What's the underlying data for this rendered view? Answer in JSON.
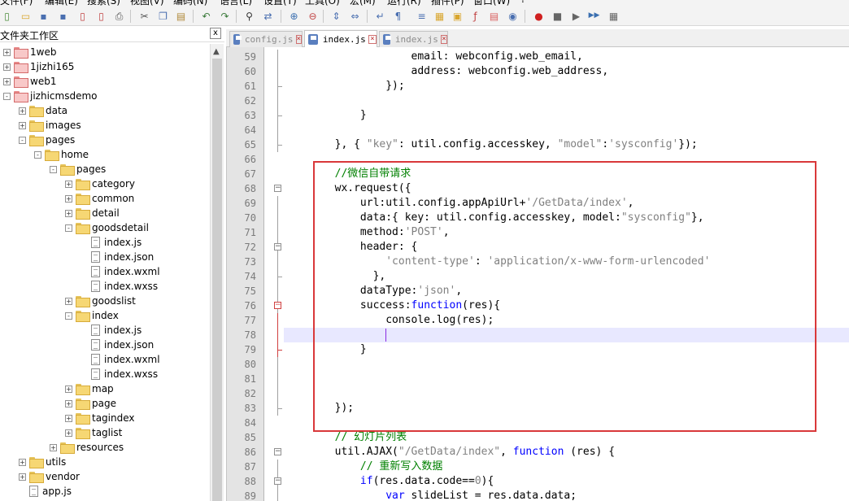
{
  "menubar": {
    "items": [
      "文件(F)",
      "编辑(E)",
      "搜索(S)",
      "视图(V)",
      "编码(N)",
      "语言(L)",
      "设置(T)",
      "工具(O)",
      "宏(M)",
      "运行(R)",
      "插件(P)",
      "窗口(W)",
      "?"
    ]
  },
  "toolbar": {
    "buttons": [
      "new-file-icon",
      "open-file-icon",
      "save-icon",
      "save-all-icon",
      "close-icon",
      "close-all-icon",
      "print-icon",
      "cut-icon",
      "copy-icon",
      "paste-icon",
      "undo-icon",
      "redo-icon",
      "find-icon",
      "replace-icon",
      "zoom-in-icon",
      "zoom-out-icon",
      "sync-vertical-icon",
      "sync-horizontal-icon",
      "word-wrap-icon",
      "show-all-chars-icon",
      "indent-guide-icon",
      "udl-icon",
      "doc-map-icon",
      "function-list-icon",
      "folder-workspace-icon",
      "monitor-icon",
      "record-macro-icon",
      "stop-macro-icon",
      "play-macro-icon",
      "run-macro-multiple-icon",
      "save-macro-icon"
    ]
  },
  "workspace": {
    "title": "文件夹工作区",
    "close_label": "x",
    "tree": [
      {
        "label": "1web",
        "level": 0,
        "type": "folder",
        "color": "red",
        "expander": "+"
      },
      {
        "label": "1jizhi165",
        "level": 0,
        "type": "folder",
        "color": "red",
        "expander": "+"
      },
      {
        "label": "web1",
        "level": 0,
        "type": "folder",
        "color": "red",
        "expander": "+"
      },
      {
        "label": "jizhicmsdemo",
        "level": 0,
        "type": "folder",
        "color": "red",
        "expander": "-"
      },
      {
        "label": "data",
        "level": 1,
        "type": "folder",
        "color": "yellow",
        "expander": "+"
      },
      {
        "label": "images",
        "level": 1,
        "type": "folder",
        "color": "yellow",
        "expander": "+"
      },
      {
        "label": "pages",
        "level": 1,
        "type": "folder",
        "color": "yellow",
        "expander": "-"
      },
      {
        "label": "home",
        "level": 2,
        "type": "folder",
        "color": "yellow",
        "expander": "-"
      },
      {
        "label": "pages",
        "level": 3,
        "type": "folder",
        "color": "yellow",
        "expander": "-"
      },
      {
        "label": "category",
        "level": 4,
        "type": "folder",
        "color": "yellow",
        "expander": "+"
      },
      {
        "label": "common",
        "level": 4,
        "type": "folder",
        "color": "yellow",
        "expander": "+"
      },
      {
        "label": "detail",
        "level": 4,
        "type": "folder",
        "color": "yellow",
        "expander": "+"
      },
      {
        "label": "goodsdetail",
        "level": 4,
        "type": "folder",
        "color": "yellow",
        "expander": "-"
      },
      {
        "label": "index.js",
        "level": 5,
        "type": "file"
      },
      {
        "label": "index.json",
        "level": 5,
        "type": "file"
      },
      {
        "label": "index.wxml",
        "level": 5,
        "type": "file"
      },
      {
        "label": "index.wxss",
        "level": 5,
        "type": "file"
      },
      {
        "label": "goodslist",
        "level": 4,
        "type": "folder",
        "color": "yellow",
        "expander": "+"
      },
      {
        "label": "index",
        "level": 4,
        "type": "folder",
        "color": "yellow",
        "expander": "-"
      },
      {
        "label": "index.js",
        "level": 5,
        "type": "file"
      },
      {
        "label": "index.json",
        "level": 5,
        "type": "file"
      },
      {
        "label": "index.wxml",
        "level": 5,
        "type": "file"
      },
      {
        "label": "index.wxss",
        "level": 5,
        "type": "file"
      },
      {
        "label": "map",
        "level": 4,
        "type": "folder",
        "color": "yellow",
        "expander": "+"
      },
      {
        "label": "page",
        "level": 4,
        "type": "folder",
        "color": "yellow",
        "expander": "+"
      },
      {
        "label": "tagindex",
        "level": 4,
        "type": "folder",
        "color": "yellow",
        "expander": "+"
      },
      {
        "label": "taglist",
        "level": 4,
        "type": "folder",
        "color": "yellow",
        "expander": "+"
      },
      {
        "label": "resources",
        "level": 3,
        "type": "folder",
        "color": "yellow",
        "expander": "+"
      },
      {
        "label": "utils",
        "level": 1,
        "type": "folder",
        "color": "yellow",
        "expander": "+"
      },
      {
        "label": "vendor",
        "level": 1,
        "type": "folder",
        "color": "yellow",
        "expander": "+"
      },
      {
        "label": "app.js",
        "level": 1,
        "type": "file"
      }
    ]
  },
  "tabs": [
    {
      "label": "config.js",
      "active": false
    },
    {
      "label": "index.js",
      "active": true
    },
    {
      "label": "index.js",
      "active": false
    }
  ],
  "editor": {
    "current_line": 78,
    "lines": [
      {
        "n": 59,
        "tokens": [
          [
            "pl",
            "                    email: webconfig.web_email,"
          ]
        ]
      },
      {
        "n": 60,
        "tokens": [
          [
            "pl",
            "                    address: webconfig.web_address,"
          ]
        ]
      },
      {
        "n": 61,
        "tokens": [
          [
            "pl",
            "                });"
          ]
        ]
      },
      {
        "n": 62,
        "tokens": []
      },
      {
        "n": 63,
        "tokens": [
          [
            "pl",
            "            }"
          ]
        ]
      },
      {
        "n": 64,
        "tokens": []
      },
      {
        "n": 65,
        "tokens": [
          [
            "pl",
            "        }, { "
          ],
          [
            "str",
            "\"key\""
          ],
          [
            "pl",
            ": util.config.accesskey, "
          ],
          [
            "str",
            "\"model\""
          ],
          [
            "pl",
            ":"
          ],
          [
            "str",
            "'sysconfig'"
          ],
          [
            "pl",
            "});"
          ]
        ]
      },
      {
        "n": 66,
        "tokens": []
      },
      {
        "n": 67,
        "tokens": [
          [
            "cm",
            "        //微信自带请求"
          ]
        ]
      },
      {
        "n": 68,
        "tokens": [
          [
            "pl",
            "        wx.request({"
          ]
        ]
      },
      {
        "n": 69,
        "tokens": [
          [
            "pl",
            "            url:util.config.appApiUrl+"
          ],
          [
            "str",
            "'/GetData/index'"
          ],
          [
            "pl",
            ","
          ]
        ]
      },
      {
        "n": 70,
        "tokens": [
          [
            "pl",
            "            data:{ key: util.config.accesskey, model:"
          ],
          [
            "str",
            "\"sysconfig\""
          ],
          [
            "pl",
            "},"
          ]
        ]
      },
      {
        "n": 71,
        "tokens": [
          [
            "pl",
            "            method:"
          ],
          [
            "str",
            "'POST'"
          ],
          [
            "pl",
            ","
          ]
        ]
      },
      {
        "n": 72,
        "tokens": [
          [
            "pl",
            "            header: {"
          ]
        ]
      },
      {
        "n": 73,
        "tokens": [
          [
            "pl",
            "                "
          ],
          [
            "str",
            "'content-type'"
          ],
          [
            "pl",
            ": "
          ],
          [
            "str",
            "'application/x-www-form-urlencoded'"
          ]
        ]
      },
      {
        "n": 74,
        "tokens": [
          [
            "pl",
            "              },"
          ]
        ]
      },
      {
        "n": 75,
        "tokens": [
          [
            "pl",
            "            dataType:"
          ],
          [
            "str",
            "'json'"
          ],
          [
            "pl",
            ","
          ]
        ]
      },
      {
        "n": 76,
        "tokens": [
          [
            "pl",
            "            success:"
          ],
          [
            "kw",
            "function"
          ],
          [
            "pl",
            "(res){"
          ]
        ]
      },
      {
        "n": 77,
        "tokens": [
          [
            "pl",
            "                console.log(res);"
          ]
        ]
      },
      {
        "n": 78,
        "tokens": []
      },
      {
        "n": 79,
        "tokens": [
          [
            "pl",
            "            }"
          ]
        ]
      },
      {
        "n": 80,
        "tokens": []
      },
      {
        "n": 81,
        "tokens": []
      },
      {
        "n": 82,
        "tokens": []
      },
      {
        "n": 83,
        "tokens": [
          [
            "pl",
            "        });"
          ]
        ]
      },
      {
        "n": 84,
        "tokens": []
      },
      {
        "n": 85,
        "tokens": [
          [
            "cm",
            "        // 幻灯片列表"
          ]
        ]
      },
      {
        "n": 86,
        "tokens": [
          [
            "pl",
            "        util.AJAX("
          ],
          [
            "str",
            "\"/GetData/index\""
          ],
          [
            "pl",
            ", "
          ],
          [
            "kw",
            "function"
          ],
          [
            "pl",
            " (res) {"
          ]
        ]
      },
      {
        "n": 87,
        "tokens": [
          [
            "cm",
            "            // 重新写入数据"
          ]
        ]
      },
      {
        "n": 88,
        "tokens": [
          [
            "pl",
            "            "
          ],
          [
            "kw",
            "if"
          ],
          [
            "pl",
            "(res.data.code=="
          ],
          [
            "str",
            "0"
          ],
          [
            "pl",
            "){"
          ]
        ]
      },
      {
        "n": 89,
        "tokens": [
          [
            "pl",
            "                "
          ],
          [
            "kw",
            "var"
          ],
          [
            "pl",
            " slideList = res.data.data;"
          ]
        ]
      }
    ]
  }
}
